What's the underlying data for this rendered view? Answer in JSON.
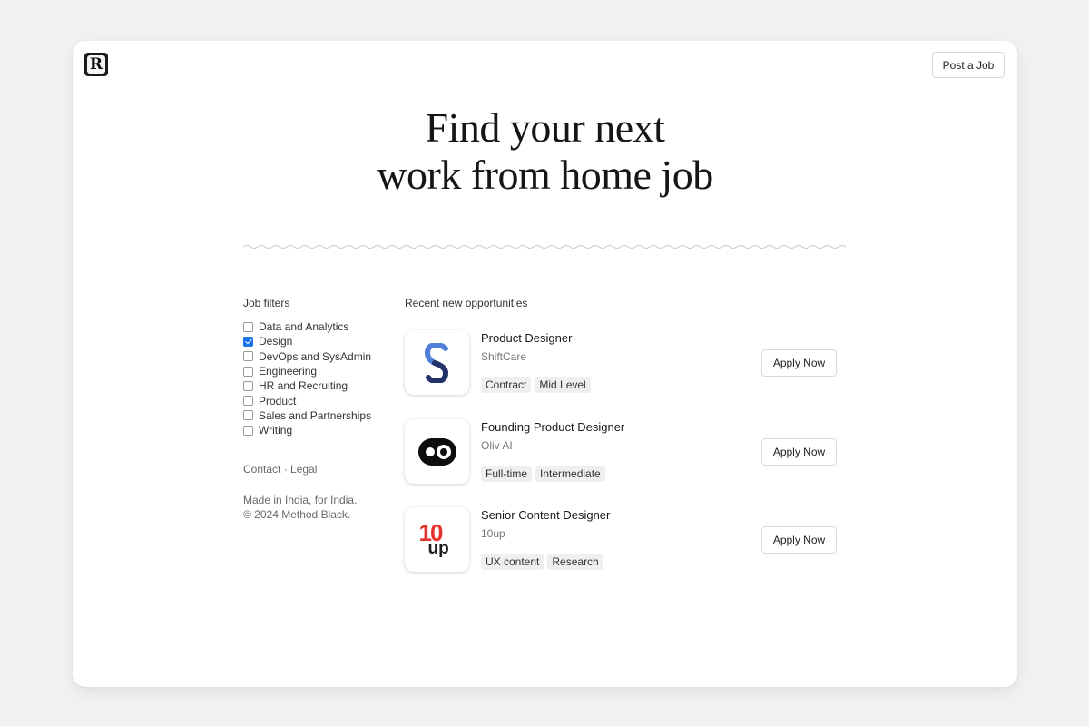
{
  "header": {
    "logo_letter": "R",
    "post_job_label": "Post a Job"
  },
  "hero": {
    "line1": "Find your next",
    "line2": "work from home job"
  },
  "filters": {
    "title": "Job filters",
    "items": [
      {
        "label": "Data and Analytics",
        "checked": false
      },
      {
        "label": "Design",
        "checked": true
      },
      {
        "label": "DevOps and SysAdmin",
        "checked": false
      },
      {
        "label": "Engineering",
        "checked": false
      },
      {
        "label": "HR and Recruiting",
        "checked": false
      },
      {
        "label": "Product",
        "checked": false
      },
      {
        "label": "Sales and Partnerships",
        "checked": false
      },
      {
        "label": "Writing",
        "checked": false
      }
    ]
  },
  "footer": {
    "contact": "Contact",
    "separator": "·",
    "legal": "Legal",
    "made_in": "Made in India, for India.",
    "copyright": "© 2024 Method Black."
  },
  "jobs": {
    "title": "Recent new opportunities",
    "apply_label": "Apply Now",
    "items": [
      {
        "title": "Product Designer",
        "company": "ShiftCare",
        "tags": [
          "Contract",
          "Mid Level"
        ],
        "logo": "shiftcare-logo"
      },
      {
        "title": "Founding Product Designer",
        "company": "Oliv AI",
        "tags": [
          "Full-time",
          "Intermediate"
        ],
        "logo": "oliv-logo"
      },
      {
        "title": "Senior Content Designer",
        "company": "10up",
        "tags": [
          "UX content",
          "Research"
        ],
        "logo": "10up-logo",
        "logo_text_top": "10",
        "logo_text_bottom": "up"
      }
    ]
  },
  "colors": {
    "checkbox_accent": "#1a73e8",
    "tenup_red": "#e5322d",
    "shiftcare_blue": "#4f7fd6",
    "shiftcare_navy": "#23326b"
  }
}
